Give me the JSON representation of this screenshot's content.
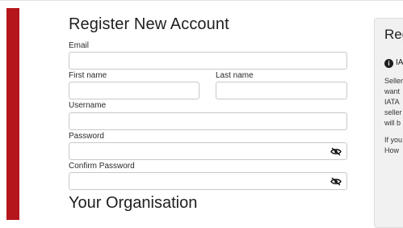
{
  "form": {
    "title": "Register New Account",
    "fields": {
      "email": {
        "label": "Email",
        "value": ""
      },
      "first_name": {
        "label": "First name",
        "value": ""
      },
      "last_name": {
        "label": "Last name",
        "value": ""
      },
      "username": {
        "label": "Username",
        "value": ""
      },
      "password": {
        "label": "Password",
        "value": ""
      },
      "confirm_password": {
        "label": "Confirm Password",
        "value": ""
      }
    },
    "section2_title": "Your Organisation"
  },
  "sidebar": {
    "title": "Reg",
    "info_title": "IA",
    "lines": [
      "Seller",
      "want",
      "IATA",
      "seller",
      "will b",
      "If you",
      "How"
    ]
  },
  "colors": {
    "accent_bar": "#b4161b"
  },
  "icons": {
    "password_toggle": "eye-slash-icon",
    "info": "info-icon"
  }
}
